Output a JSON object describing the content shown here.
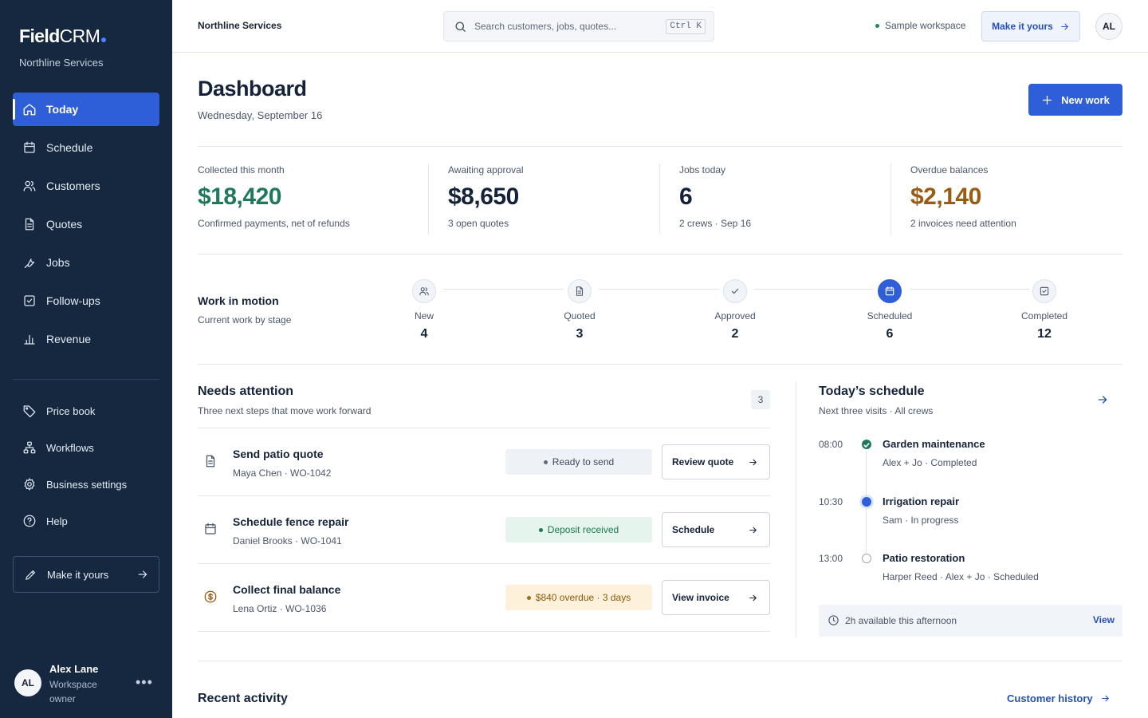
{
  "app": {
    "brand_bold": "Field",
    "brand_light": "CRM",
    "workspace": "Northline Services"
  },
  "sidebar": {
    "items": [
      {
        "label": "Today",
        "icon": "home-icon",
        "active": true
      },
      {
        "label": "Schedule",
        "icon": "calendar-icon"
      },
      {
        "label": "Customers",
        "icon": "users-icon"
      },
      {
        "label": "Quotes",
        "icon": "document-icon"
      },
      {
        "label": "Jobs",
        "icon": "wrench-icon"
      },
      {
        "label": "Follow-ups",
        "icon": "checkbox-icon"
      },
      {
        "label": "Revenue",
        "icon": "bar-chart-icon"
      }
    ],
    "secondary": [
      {
        "label": "Price book",
        "icon": "tag-icon"
      },
      {
        "label": "Workflows",
        "icon": "workflow-icon"
      },
      {
        "label": "Business settings",
        "icon": "gear-icon"
      },
      {
        "label": "Help",
        "icon": "help-icon"
      }
    ],
    "make_yours": "Make it yours",
    "user": {
      "initials": "AL",
      "name": "Alex Lane",
      "role": "Workspace owner",
      "more": "•••"
    }
  },
  "topbar": {
    "company": "Northline Services",
    "search_placeholder": "Search customers, jobs, quotes...",
    "shortcut": "Ctrl K",
    "sample_label": "Sample workspace",
    "make_yours": "Make it yours",
    "avatar": "AL"
  },
  "header": {
    "title": "Dashboard",
    "date": "Wednesday, September 16",
    "new_work": "New work"
  },
  "kpis": [
    {
      "label": "Collected this month",
      "value": "$18,420",
      "note": "Confirmed payments, net of refunds",
      "color": "#1f7a5a"
    },
    {
      "label": "Awaiting approval",
      "value": "$8,650",
      "note": "3 open quotes",
      "color": "#15233a"
    },
    {
      "label": "Jobs today",
      "value": "6",
      "note": "2 crews · Sep 16",
      "color": "#15233a"
    },
    {
      "label": "Overdue balances",
      "value": "$2,140",
      "note": "2 invoices need attention",
      "color": "#9a5b12"
    }
  ],
  "work_in_motion": {
    "title": "Work in motion",
    "subtitle": "Current work by stage",
    "stages": [
      {
        "label": "New",
        "count": "4",
        "icon": "users-icon"
      },
      {
        "label": "Quoted",
        "count": "3",
        "icon": "document-icon"
      },
      {
        "label": "Approved",
        "count": "2",
        "icon": "check-icon"
      },
      {
        "label": "Scheduled",
        "count": "6",
        "icon": "calendar-icon",
        "active": true
      },
      {
        "label": "Completed",
        "count": "12",
        "icon": "checkbox-icon"
      }
    ]
  },
  "needs_attention": {
    "title": "Needs attention",
    "subtitle": "Three next steps that move work forward",
    "count": "3",
    "tasks": [
      {
        "title": "Send patio quote",
        "meta": "Maya Chen · WO-1042",
        "badge": "Ready to send",
        "badge_tone": "gray",
        "action": "Review quote",
        "icon": "document-icon"
      },
      {
        "title": "Schedule fence repair",
        "meta": "Daniel Brooks · WO-1041",
        "badge": "Deposit received",
        "badge_tone": "green",
        "action": "Schedule",
        "icon": "calendar-icon"
      },
      {
        "title": "Collect final balance",
        "meta": "Lena Ortiz · WO-1036",
        "badge": "$840 overdue · 3 days",
        "badge_tone": "amber",
        "action": "View invoice",
        "icon": "dollar-icon"
      }
    ]
  },
  "schedule": {
    "title": "Today’s schedule",
    "subtitle": "Next three visits · All crews",
    "visits": [
      {
        "time": "08:00",
        "title": "Garden maintenance",
        "meta": "Alex + Jo · Completed",
        "status": "completed"
      },
      {
        "time": "10:30",
        "title": "Irrigation repair",
        "meta": "Sam · In progress",
        "status": "in-progress"
      },
      {
        "time": "13:00",
        "title": "Patio restoration",
        "meta": "Harper Reed · Alex + Jo · Scheduled",
        "status": "scheduled"
      }
    ],
    "availability": "2h available this afternoon",
    "availability_link": "View"
  },
  "recent_activity": {
    "title": "Recent activity",
    "link": "Customer history"
  }
}
